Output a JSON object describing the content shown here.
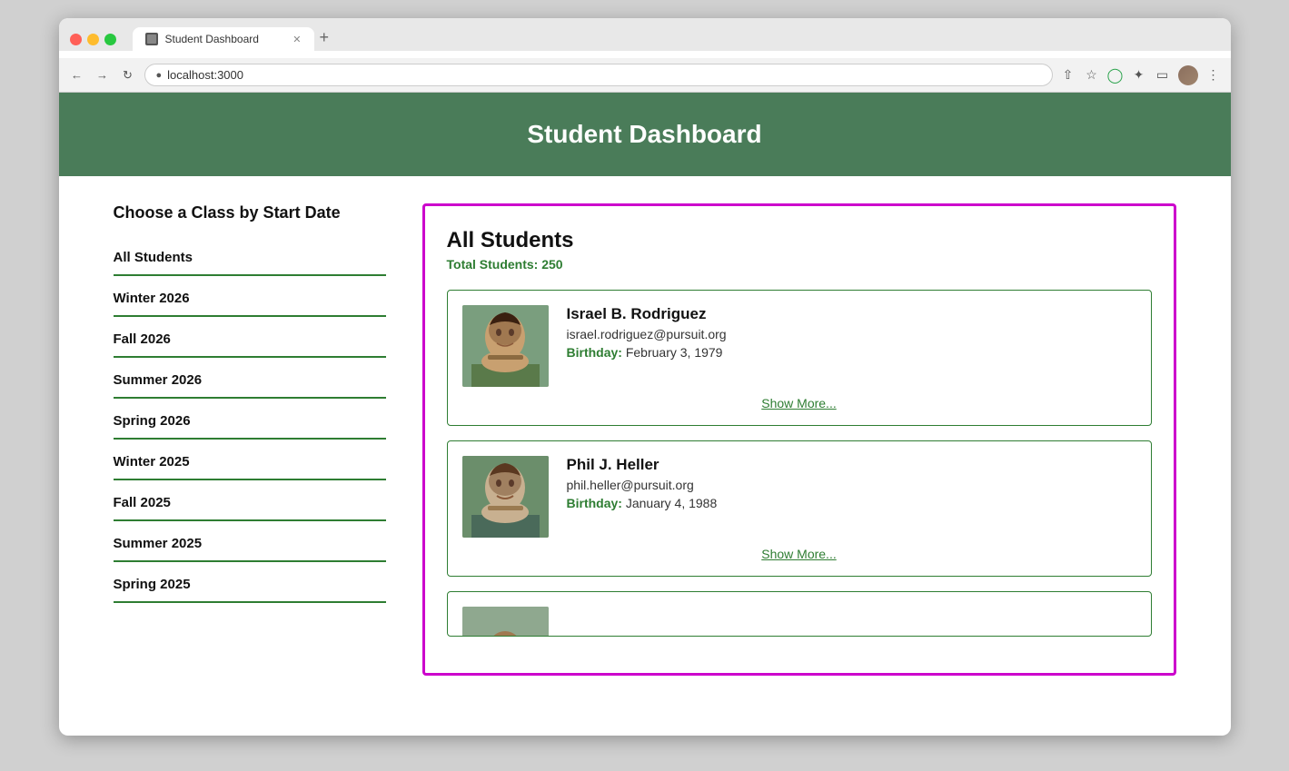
{
  "browser": {
    "tab_title": "Student Dashboard",
    "url": "localhost:3000",
    "new_tab_label": "+"
  },
  "page": {
    "header_title": "Student Dashboard",
    "sidebar": {
      "title": "Choose a Class by Start Date",
      "items": [
        {
          "label": "All Students",
          "id": "all"
        },
        {
          "label": "Winter 2026",
          "id": "winter-2026"
        },
        {
          "label": "Fall 2026",
          "id": "fall-2026"
        },
        {
          "label": "Summer 2026",
          "id": "summer-2026"
        },
        {
          "label": "Spring 2026",
          "id": "spring-2026"
        },
        {
          "label": "Winter 2025",
          "id": "winter-2025"
        },
        {
          "label": "Fall 2025",
          "id": "fall-2025"
        },
        {
          "label": "Summer 2025",
          "id": "summer-2025"
        },
        {
          "label": "Spring 2025",
          "id": "spring-2025"
        }
      ]
    },
    "panel": {
      "title": "All Students",
      "subtitle_prefix": "Total Students:",
      "total_students": "250",
      "students": [
        {
          "id": "israel-rodriguez",
          "name": "Israel B. Rodriguez",
          "email": "israel.rodriguez@pursuit.org",
          "birthday_label": "Birthday:",
          "birthday": "February 3, 1979",
          "show_more": "Show More...",
          "avatar_class": "avatar-israel"
        },
        {
          "id": "phil-heller",
          "name": "Phil J. Heller",
          "email": "phil.heller@pursuit.org",
          "birthday_label": "Birthday:",
          "birthday": "January 4, 1988",
          "show_more": "Show More...",
          "avatar_class": "avatar-phil"
        },
        {
          "id": "third-student",
          "name": "",
          "email": "",
          "birthday_label": "",
          "birthday": "",
          "show_more": "",
          "avatar_class": "avatar-third"
        }
      ]
    }
  }
}
